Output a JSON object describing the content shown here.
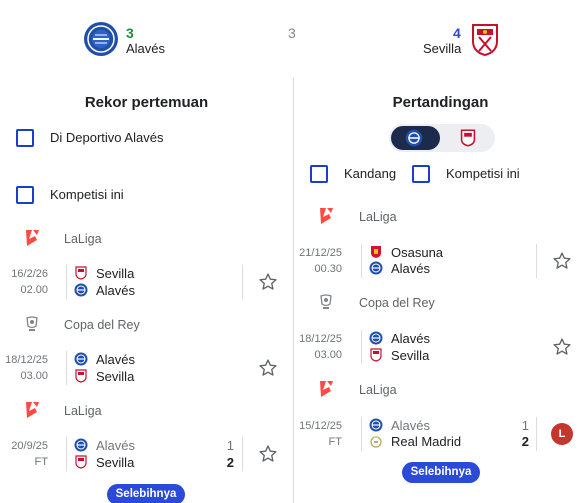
{
  "header": {
    "home": {
      "name": "Alavés",
      "score": "3",
      "score_color": "#1e8e3e"
    },
    "away": {
      "name": "Sevilla",
      "score": "4",
      "score_color": "#2b4ad8"
    },
    "center_value": "3"
  },
  "left": {
    "title": "Rekor pertemuan",
    "filters": [
      {
        "label": "Di Deportivo Alavés",
        "checked": false
      },
      {
        "label": "Kompetisi ini",
        "checked": false
      }
    ],
    "groups": [
      {
        "competition": "LaLiga",
        "competition_icon": "laliga-icon",
        "match": {
          "date": "16/2/26",
          "status": "02.00",
          "home": {
            "name": "Sevilla",
            "icon": "sevilla-crest-icon",
            "score": ""
          },
          "away": {
            "name": "Alavés",
            "icon": "alaves-crest-icon",
            "score": ""
          }
        }
      },
      {
        "competition": "Copa del Rey",
        "competition_icon": "copa-del-rey-icon",
        "match": {
          "date": "18/12/25",
          "status": "03.00",
          "home": {
            "name": "Alavés",
            "icon": "alaves-crest-icon",
            "score": ""
          },
          "away": {
            "name": "Sevilla",
            "icon": "sevilla-crest-icon",
            "score": ""
          }
        }
      },
      {
        "competition": "LaLiga",
        "competition_icon": "laliga-icon",
        "match": {
          "date": "20/9/25",
          "status": "FT",
          "home": {
            "name": "Alavés",
            "icon": "alaves-crest-icon",
            "score": "1"
          },
          "away": {
            "name": "Sevilla",
            "icon": "sevilla-crest-icon",
            "score": "2"
          }
        }
      }
    ],
    "more_label": "Selebihnya"
  },
  "right": {
    "title": "Pertandingan",
    "toggle": {
      "selected": "alaves-crest-icon",
      "other": "sevilla-crest-icon"
    },
    "filters": [
      {
        "label": "Kandang",
        "checked": false
      },
      {
        "label": "Kompetisi ini",
        "checked": false
      }
    ],
    "groups": [
      {
        "competition": "LaLiga",
        "competition_icon": "laliga-icon",
        "match": {
          "date": "21/12/25",
          "status": "00.30",
          "home": {
            "name": "Osasuna",
            "icon": "osasuna-crest-icon",
            "score": ""
          },
          "away": {
            "name": "Alavés",
            "icon": "alaves-crest-icon",
            "score": ""
          }
        }
      },
      {
        "competition": "Copa del Rey",
        "competition_icon": "copa-del-rey-icon",
        "match": {
          "date": "18/12/25",
          "status": "03.00",
          "home": {
            "name": "Alavés",
            "icon": "alaves-crest-icon",
            "score": ""
          },
          "away": {
            "name": "Sevilla",
            "icon": "sevilla-crest-icon",
            "score": ""
          }
        }
      },
      {
        "competition": "LaLiga",
        "competition_icon": "laliga-icon",
        "match": {
          "date": "15/12/25",
          "status": "FT",
          "home": {
            "name": "Alavés",
            "icon": "alaves-crest-icon",
            "score": "1"
          },
          "away": {
            "name": "Real Madrid",
            "icon": "real-madrid-crest-icon",
            "score": "2"
          },
          "result_badge": "L"
        }
      }
    ],
    "more_label": "Selebihnya"
  },
  "colors": {
    "accent": "#2b4ad8",
    "laliga_red": "#ff4b44",
    "loss_badge": "#c5362d"
  }
}
